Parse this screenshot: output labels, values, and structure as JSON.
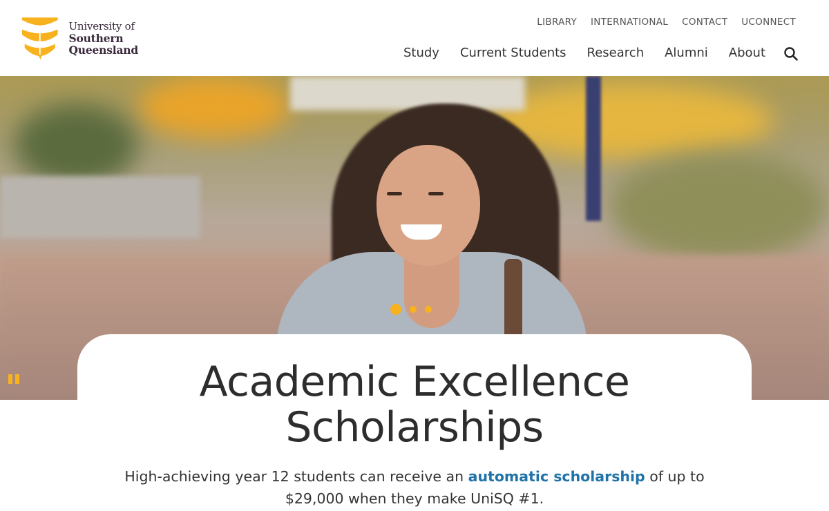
{
  "logo": {
    "line1": "University of",
    "line2": "Southern",
    "line3": "Queensland"
  },
  "utility_nav": [
    "LIBRARY",
    "INTERNATIONAL",
    "CONTACT",
    "UCONNECT"
  ],
  "main_nav": [
    "Study",
    "Current Students",
    "Research",
    "Alumni",
    "About"
  ],
  "search": {
    "icon": "search-icon"
  },
  "hero": {
    "carousel_dots": 3,
    "active_dot": 0,
    "pause_icon": "pause-icon"
  },
  "content": {
    "title_line1": "Academic Excellence",
    "title_line2": "Scholarships",
    "subtitle_before": "High-achieving year 12 students can receive an ",
    "subtitle_link": "automatic scholarship",
    "subtitle_after": " of up to $29,000 when they make UniSQ #1."
  },
  "colors": {
    "accent": "#f7b21e",
    "link": "#1f73a8",
    "logo_text": "#3a2a3c"
  }
}
